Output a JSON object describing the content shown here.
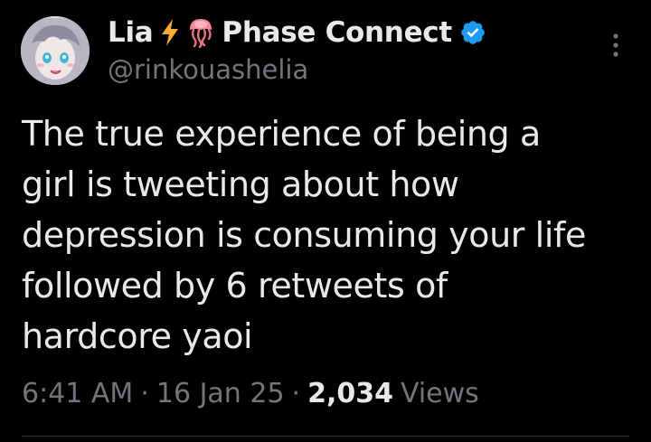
{
  "author": {
    "display_name": "Lia",
    "affiliation": "Phase Connect",
    "handle": "@rinkouashelia",
    "verified": true,
    "icons": [
      "lightning-bolt-icon",
      "jellyfish-icon",
      "verified-badge-icon"
    ]
  },
  "tweet": {
    "text": "The true experience of being a girl is tweeting about how depression is consuming your life followed by 6 retweets of hardcore yaoi",
    "time": "6:41 AM",
    "date": "16 Jan 25",
    "views_count": "2,034",
    "views_label": "Views",
    "separator": "·"
  },
  "colors": {
    "background": "#000000",
    "primary_text": "#e7e9ea",
    "secondary_text": "#71767b",
    "verified_blue": "#1d9bf0",
    "bolt_yellow": "#ffac33"
  }
}
